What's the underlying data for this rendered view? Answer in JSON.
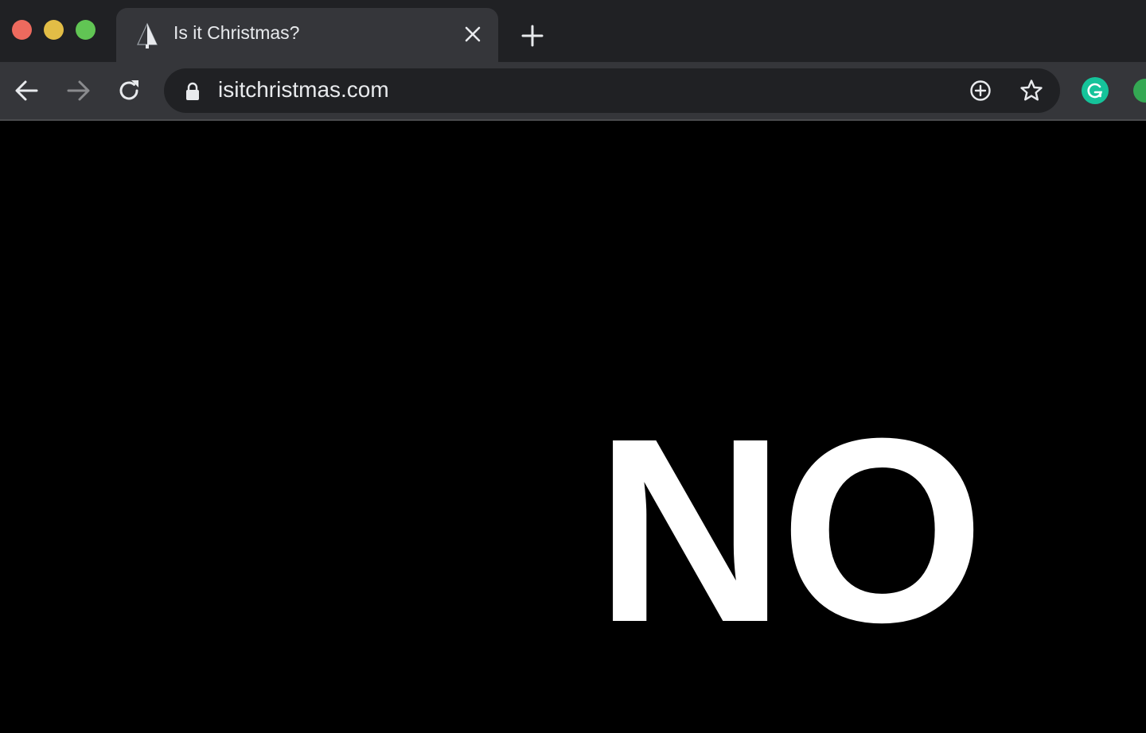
{
  "tab": {
    "title": "Is it Christmas?",
    "favicon": "christmas-tree-icon"
  },
  "toolbar": {
    "url": "isitchristmas.com",
    "back_icon": "arrow-left-icon",
    "forward_icon": "arrow-right-icon",
    "reload_icon": "reload-icon",
    "lock_icon": "lock-icon",
    "install_icon": "plus-circle-icon",
    "bookmark_icon": "star-icon"
  },
  "extensions": [
    {
      "name": "grammarly-icon",
      "color": "#15c39a"
    },
    {
      "name": "green-extension-icon",
      "color": "#34a853"
    }
  ],
  "page": {
    "answer": "NO"
  },
  "colors": {
    "traffic_close": "#ed6a5e",
    "traffic_minimize": "#e2bd46",
    "traffic_maximize": "#61c554",
    "page_background": "#000000",
    "answer_text": "#ffffff"
  }
}
